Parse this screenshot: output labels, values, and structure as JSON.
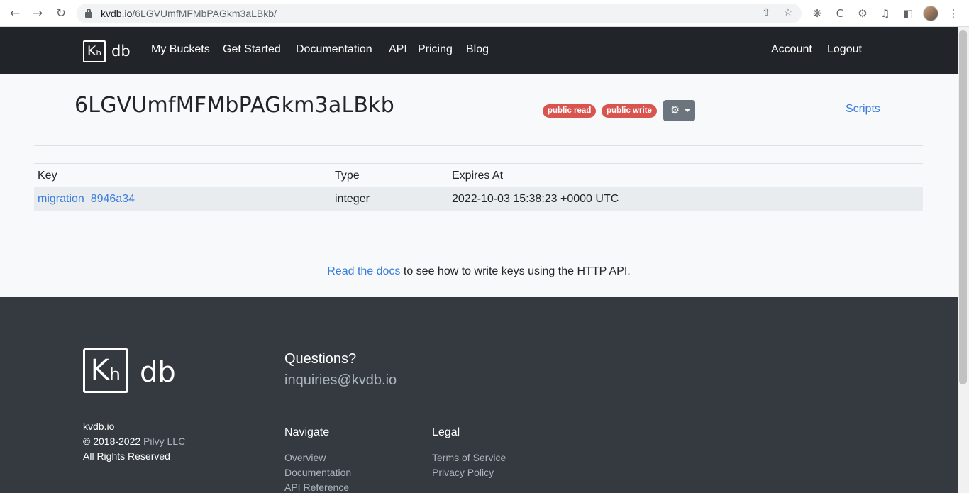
{
  "browser": {
    "url_host": "kvdb.io",
    "url_path": "/6LGVUmfMFMbPAGkm3aLBkb/"
  },
  "navbar": {
    "logo_kv": "Kₕ",
    "logo_db": "db",
    "links": [
      "My Buckets",
      "Get Started",
      "Documentation",
      "API",
      "Pricing",
      "Blog"
    ],
    "account": "Account",
    "logout": "Logout"
  },
  "bucket": {
    "title": "6LGVUmfMFMbPAGkm3aLBkb",
    "badges": [
      "public read",
      "public write"
    ],
    "scripts_label": "Scripts"
  },
  "table": {
    "headers": [
      "Key",
      "Type",
      "Expires At"
    ],
    "rows": [
      {
        "key": "migration_8946a34",
        "type": "integer",
        "expires_at": "2022-10-03 15:38:23 +0000 UTC"
      }
    ]
  },
  "docs_hint": {
    "link_text": "Read the docs",
    "rest": "to see how to write keys using the HTTP API."
  },
  "footer": {
    "logo_db": "db",
    "site": "kvdb.io",
    "copyright_prefix": "© 2018-2022",
    "company": "Pilvy LLC",
    "rights": "All Rights Reserved",
    "questions_heading": "Questions?",
    "email": "inquiries@kvdb.io",
    "navigate_heading": "Navigate",
    "navigate_links": [
      "Overview",
      "Documentation",
      "API Reference"
    ],
    "legal_heading": "Legal",
    "legal_links": [
      "Terms of Service",
      "Privacy Policy"
    ]
  },
  "colors": {
    "navbar_bg": "#212529",
    "footer_bg": "#343a40",
    "link": "#3b7ddd",
    "badge": "#d9534f"
  }
}
